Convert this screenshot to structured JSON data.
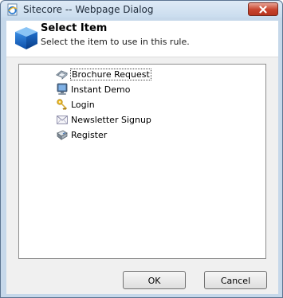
{
  "window": {
    "title": "Sitecore -- Webpage Dialog",
    "app_icon": "ie-page-icon",
    "close_icon": "close-x-icon"
  },
  "header": {
    "title": "Select Item",
    "subtitle": "Select the item to use in this rule.",
    "icon": "blue-cube-icon"
  },
  "tree": {
    "items": [
      {
        "label": "Brochure Request",
        "icon": "brochure-icon",
        "selected": true
      },
      {
        "label": "Instant Demo",
        "icon": "monitor-icon",
        "selected": false
      },
      {
        "label": "Login",
        "icon": "keys-icon",
        "selected": false
      },
      {
        "label": "Newsletter Signup",
        "icon": "envelope-icon",
        "selected": false
      },
      {
        "label": "Register",
        "icon": "register-icon",
        "selected": false
      }
    ]
  },
  "buttons": {
    "ok_label": "OK",
    "cancel_label": "Cancel"
  },
  "colors": {
    "frame": "#c6d8ea",
    "close_button": "#c7422c",
    "dialog_background": "#f0f0f0"
  }
}
